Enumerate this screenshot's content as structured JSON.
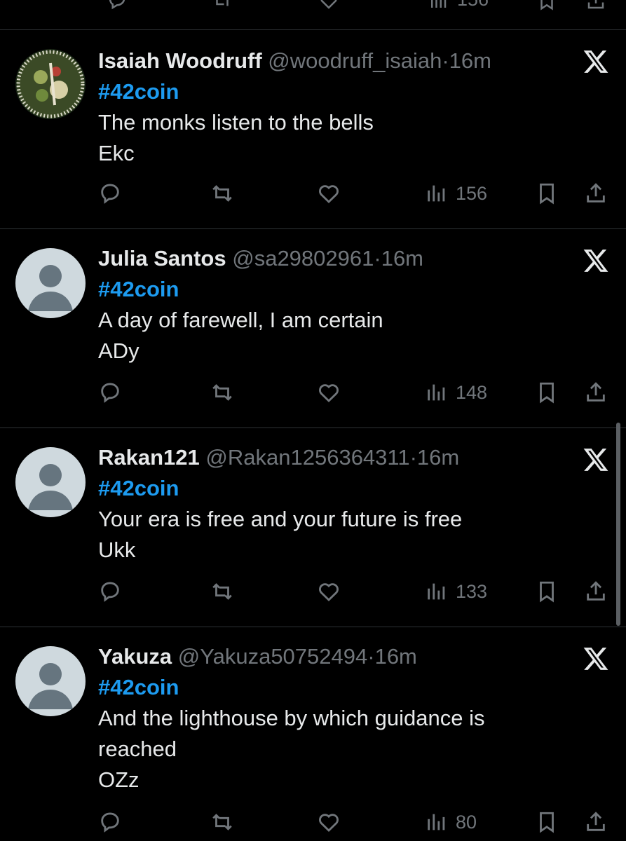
{
  "top_partial": {
    "views": "156"
  },
  "tweets": [
    {
      "name": "Isaiah Woodruff",
      "handle": "@woodruff_isaiah",
      "dot": "·",
      "time": "16m",
      "hashtag": "#42coin",
      "line1": "The monks listen to the bells",
      "line2": "Ekc",
      "line3": "",
      "views": "156",
      "avatar": "photo"
    },
    {
      "name": "Julia Santos",
      "handle": "@sa29802961",
      "dot": "·",
      "time": "16m",
      "hashtag": "#42coin",
      "line1": "A day of farewell, I am certain",
      "line2": "ADy",
      "line3": "",
      "views": "148",
      "avatar": "default"
    },
    {
      "name": "Rakan121",
      "handle": "@Rakan1256364311",
      "dot": "·",
      "time": "16m",
      "hashtag": "#42coin",
      "line1": "Your era is free and your future is free",
      "line2": "Ukk",
      "line3": "",
      "views": "133",
      "avatar": "default"
    },
    {
      "name": "Yakuza",
      "handle": "@Yakuza50752494",
      "dot": "·",
      "time": "16m",
      "hashtag": "#42coin",
      "line1": "And the lighthouse by which guidance is",
      "line2": "reached",
      "line3": "OZz",
      "views": "80",
      "avatar": "default"
    }
  ],
  "icons": {
    "reply": "reply-icon",
    "retweet": "retweet-icon",
    "like": "heart-icon",
    "views": "views-icon",
    "bookmark": "bookmark-icon",
    "share": "share-icon",
    "logo": "x-logo-icon"
  },
  "colors": {
    "background": "#000000",
    "text": "#e7e9ea",
    "muted": "#71767b",
    "accent": "#1d9bf0",
    "divider": "#2f3336"
  }
}
